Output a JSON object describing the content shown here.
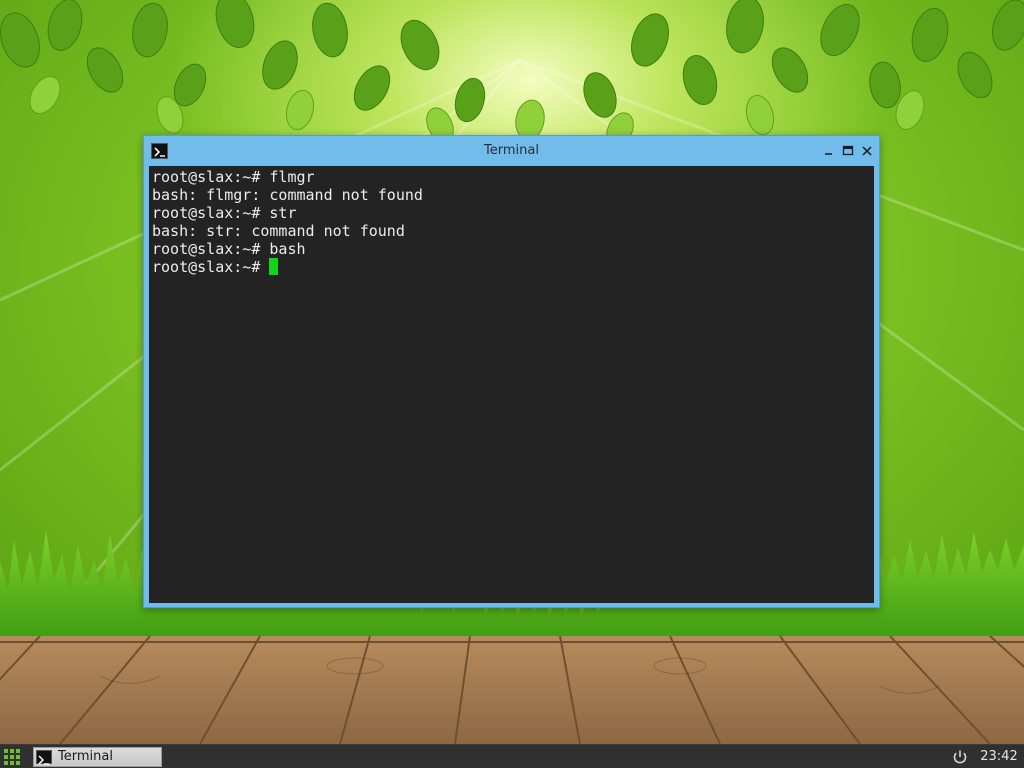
{
  "window": {
    "title": "Terminal",
    "icon": "terminal-icon",
    "controls": [
      "minimize-icon",
      "maximize-icon",
      "close-icon"
    ]
  },
  "terminal": {
    "lines": [
      "root@slax:~# flmgr",
      "bash: flmgr: command not found",
      "root@slax:~# str",
      "bash: str: command not found",
      "root@slax:~# bash"
    ],
    "prompt": "root@slax:~# ",
    "cursor_color": "#12d41a",
    "background_color": "#232323",
    "text_color": "#ececec"
  },
  "taskbar": {
    "start_icon": "app-grid-icon",
    "items": [
      {
        "label": "Terminal",
        "icon": "terminal-icon"
      }
    ],
    "power_icon": "power-icon",
    "clock": "23:42"
  },
  "colors": {
    "window_frame": "#72bceb",
    "taskbar": "#303030",
    "accent_green": "#6db51e"
  }
}
